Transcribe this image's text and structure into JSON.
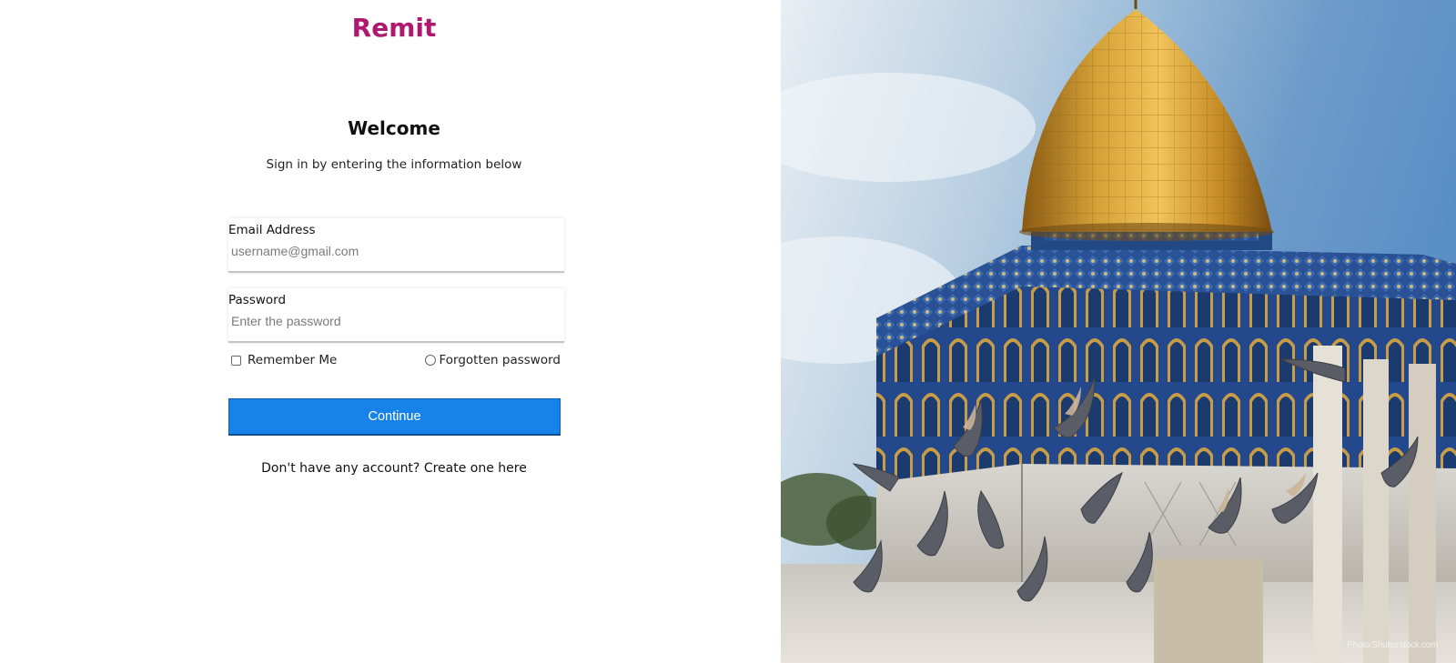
{
  "brand": {
    "name": "Remit",
    "color": "#b0176e"
  },
  "heading": {
    "title": "Welcome",
    "subtitle": "Sign in by entering the information below"
  },
  "form": {
    "email": {
      "label": "Email Address",
      "placeholder": "username@gmail.com"
    },
    "password": {
      "label": "Password",
      "placeholder": "Enter the password"
    },
    "remember_label": "Remember Me",
    "remember_checked": false,
    "forgot_label": "Forgotten password",
    "submit_label": "Continue",
    "submit_color": "#1783ea"
  },
  "signup": {
    "prompt": "Don't have any account?",
    "link_label": "Create one here"
  },
  "hero": {
    "credit": "Photo:Shutterstock.com"
  }
}
